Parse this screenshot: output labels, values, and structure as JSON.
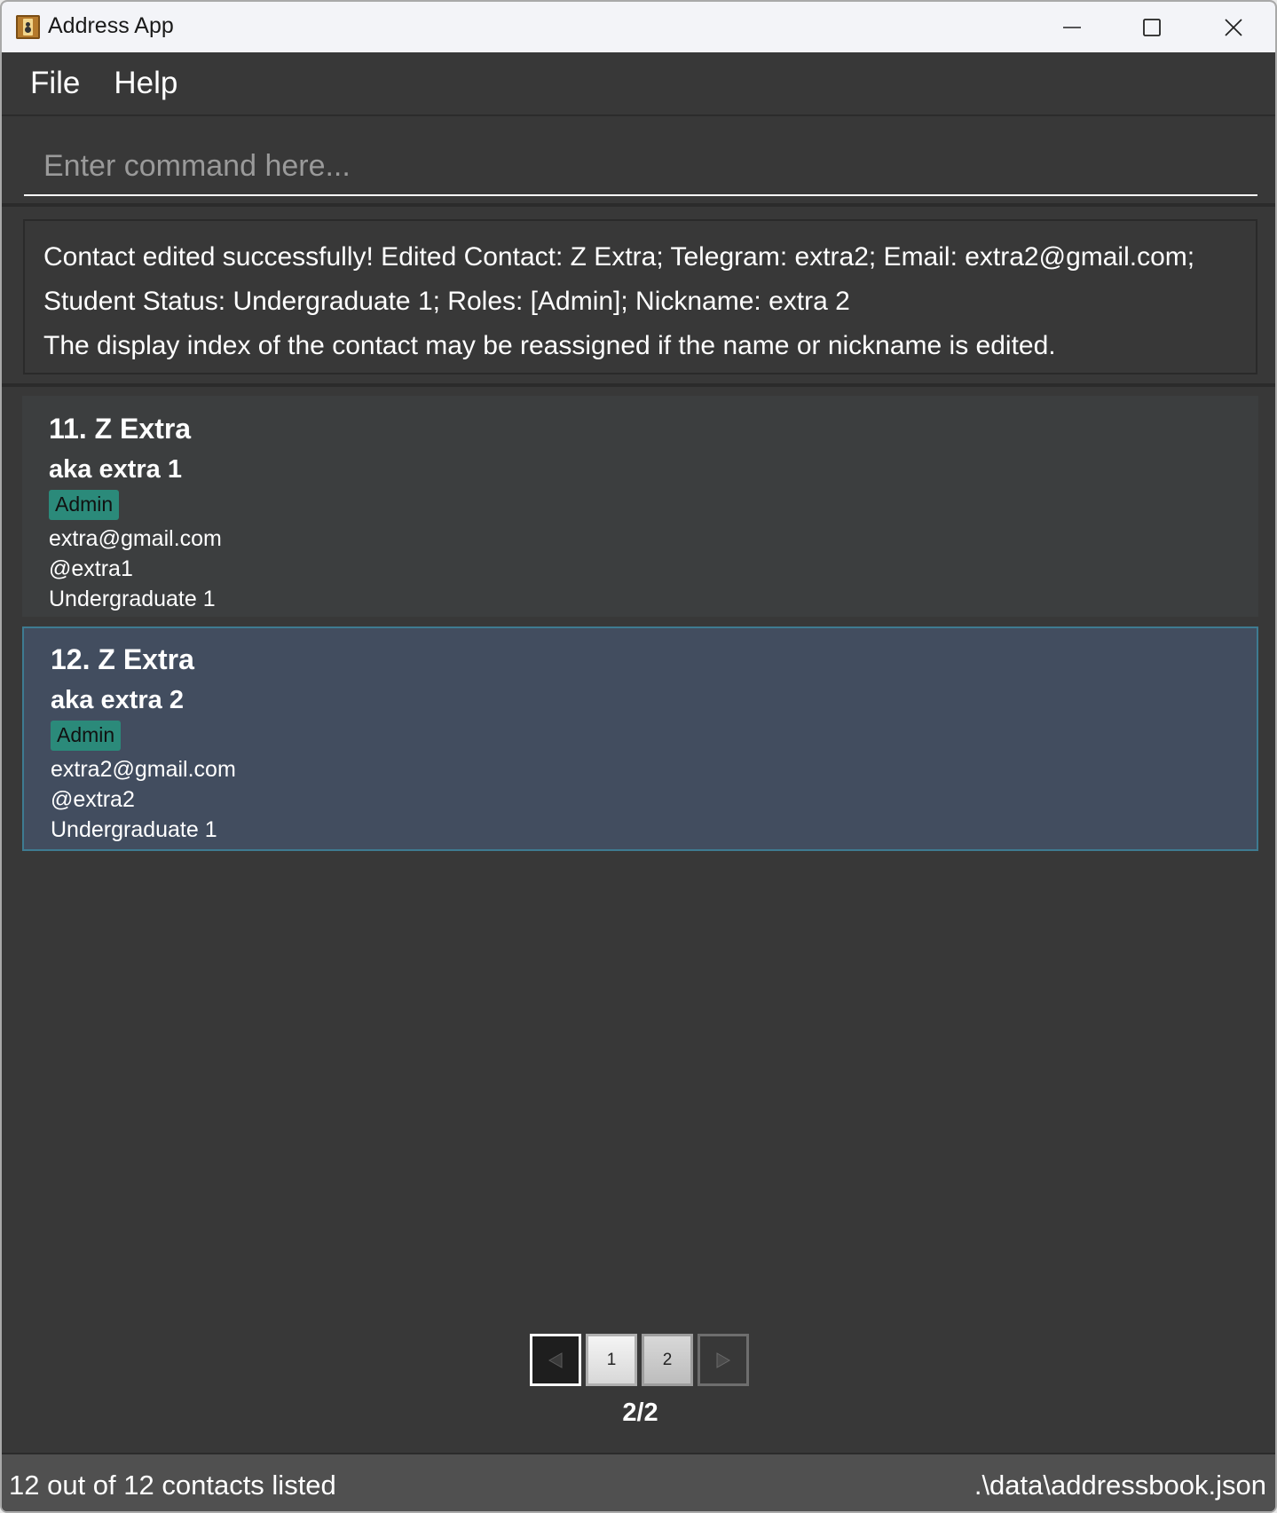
{
  "window": {
    "title": "Address App",
    "icon": "address-book-icon",
    "controls": [
      "minimize-icon",
      "maximize-icon",
      "close-icon"
    ]
  },
  "menu": {
    "items": [
      "File",
      "Help"
    ]
  },
  "command": {
    "value": "",
    "placeholder": "Enter command here..."
  },
  "result": {
    "lines": [
      "Contact edited successfully! Edited Contact: Z Extra; Telegram: extra2; Email: extra2@gmail.com;",
      "Student Status: Undergraduate 1; Roles: [Admin]; Nickname: extra 2",
      "The display index of the contact may be reassigned if the name or nickname is edited."
    ]
  },
  "contacts": [
    {
      "title": "11. Z Extra",
      "nickname": "aka extra 1",
      "tag": "Admin",
      "email": "extra@gmail.com",
      "telegram": "@extra1",
      "status": "Undergraduate 1",
      "selected": false
    },
    {
      "title": "12. Z Extra",
      "nickname": "aka extra 2",
      "tag": "Admin",
      "email": "extra2@gmail.com",
      "telegram": "@extra2",
      "status": "Undergraduate 1",
      "selected": true
    }
  ],
  "pagination": {
    "prev_icon": "triangle-left-icon",
    "pages": [
      "1",
      "2"
    ],
    "next_icon": "triangle-right-icon",
    "current_label": "2/2"
  },
  "status": {
    "left": "12 out of 12 contacts listed",
    "right": ".\\data\\addressbook.json"
  },
  "colors": {
    "background": "#383838",
    "card": "#3c3e3f",
    "card_selected": "#424d5f",
    "selected_border": "#3e7b91",
    "tag": "#2b8a7a",
    "statusbar": "#505050"
  }
}
